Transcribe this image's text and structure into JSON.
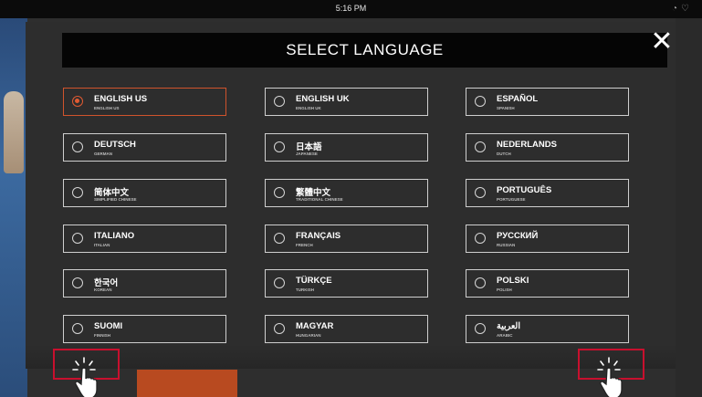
{
  "status_bar": {
    "time": "5:16 PM",
    "icons": [
      "headset-icon",
      "shield-icon"
    ]
  },
  "dialog": {
    "title": "SELECT LANGUAGE",
    "close_icon": "close-icon",
    "selected": "ENGLISH US"
  },
  "languages": [
    {
      "name": "ENGLISH US",
      "sub": "ENGLISH US",
      "selected": true
    },
    {
      "name": "ENGLISH UK",
      "sub": "ENGLISH UK",
      "selected": false
    },
    {
      "name": "ESPAÑOL",
      "sub": "SPANISH",
      "selected": false
    },
    {
      "name": "DEUTSCH",
      "sub": "GERMAN",
      "selected": false
    },
    {
      "name": "日本語",
      "sub": "JAPANESE",
      "selected": false
    },
    {
      "name": "NEDERLANDS",
      "sub": "DUTCH",
      "selected": false
    },
    {
      "name": "简体中文",
      "sub": "SIMPLIFIED CHINESE",
      "selected": false
    },
    {
      "name": "繁體中文",
      "sub": "TRADITIONAL CHINESE",
      "selected": false
    },
    {
      "name": "PORTUGUÊS",
      "sub": "PORTUGUESE",
      "selected": false
    },
    {
      "name": "ITALIANO",
      "sub": "ITALIAN",
      "selected": false
    },
    {
      "name": "FRANÇAIS",
      "sub": "FRENCH",
      "selected": false
    },
    {
      "name": "РУССКИЙ",
      "sub": "RUSSIAN",
      "selected": false
    },
    {
      "name": "한국어",
      "sub": "KOREAN",
      "selected": false
    },
    {
      "name": "TÜRKÇE",
      "sub": "TURKISH",
      "selected": false
    },
    {
      "name": "POLSKI",
      "sub": "POLISH",
      "selected": false
    },
    {
      "name": "SUOMI",
      "sub": "FINNISH",
      "selected": false
    },
    {
      "name": "MAGYAR",
      "sub": "HUNGARIAN",
      "selected": false
    },
    {
      "name": "العربية",
      "sub": "ARABIC",
      "selected": false
    }
  ],
  "colors": {
    "accent": "#d0532c",
    "tap_highlight": "#c8102e",
    "header_bg": "#050505",
    "panel_bg": "#2d2d2d"
  },
  "tap_hints": [
    {
      "icon": "tap-hand-icon"
    },
    {
      "icon": "tap-hand-icon"
    }
  ]
}
